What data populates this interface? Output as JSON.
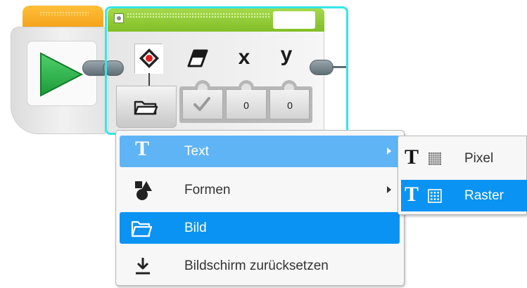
{
  "display_block": {
    "params": {
      "x_label": "x",
      "y_label": "y",
      "x_value": "0",
      "y_value": "0"
    }
  },
  "menu": {
    "items": [
      {
        "label": "Text",
        "icon": "text-T-icon",
        "has_submenu": true
      },
      {
        "label": "Formen",
        "icon": "shapes-icon",
        "has_submenu": true
      },
      {
        "label": "Bild",
        "icon": "folder-icon",
        "has_submenu": false
      },
      {
        "label": "Bildschirm zurücksetzen",
        "icon": "download-arrow-icon",
        "has_submenu": false
      }
    ]
  },
  "submenu": {
    "items": [
      {
        "label": "Pixel",
        "icon": "text-pixel-icon"
      },
      {
        "label": "Raster",
        "icon": "text-grid-icon"
      }
    ]
  },
  "colors": {
    "start_header": "#f5a623",
    "display_header": "#8cc63f",
    "selection": "#34e6e6",
    "menu_highlight": "#0b93f3",
    "menu_highlight_light": "#5fb4f6"
  }
}
